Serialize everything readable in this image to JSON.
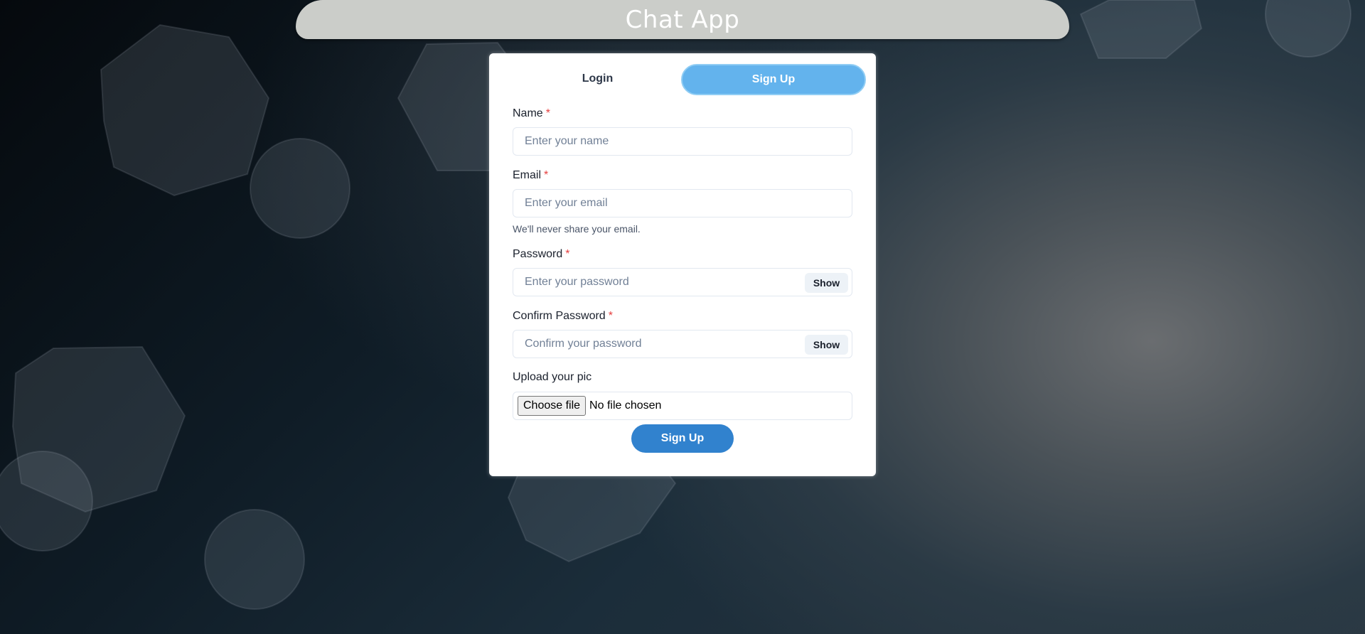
{
  "header": {
    "title": "Chat App"
  },
  "tabs": {
    "login_label": "Login",
    "signup_label": "Sign Up"
  },
  "form": {
    "name": {
      "label": "Name",
      "required_mark": "*",
      "placeholder": "Enter your name"
    },
    "email": {
      "label": "Email",
      "required_mark": "*",
      "placeholder": "Enter your email",
      "helper": "We'll never share your email."
    },
    "password": {
      "label": "Password",
      "required_mark": "*",
      "placeholder": "Enter your password",
      "toggle_label": "Show"
    },
    "confirm_password": {
      "label": "Confirm Password",
      "required_mark": "*",
      "placeholder": "Confirm your password",
      "toggle_label": "Show"
    },
    "upload": {
      "label": "Upload your pic",
      "button_label": "Choose file",
      "status": "No file chosen"
    },
    "submit_label": "Sign Up"
  },
  "colors": {
    "accent": "#3182ce",
    "active_tab": "#63b3ed",
    "required": "#e53e3e",
    "header_bg": "#cbcdc9"
  }
}
